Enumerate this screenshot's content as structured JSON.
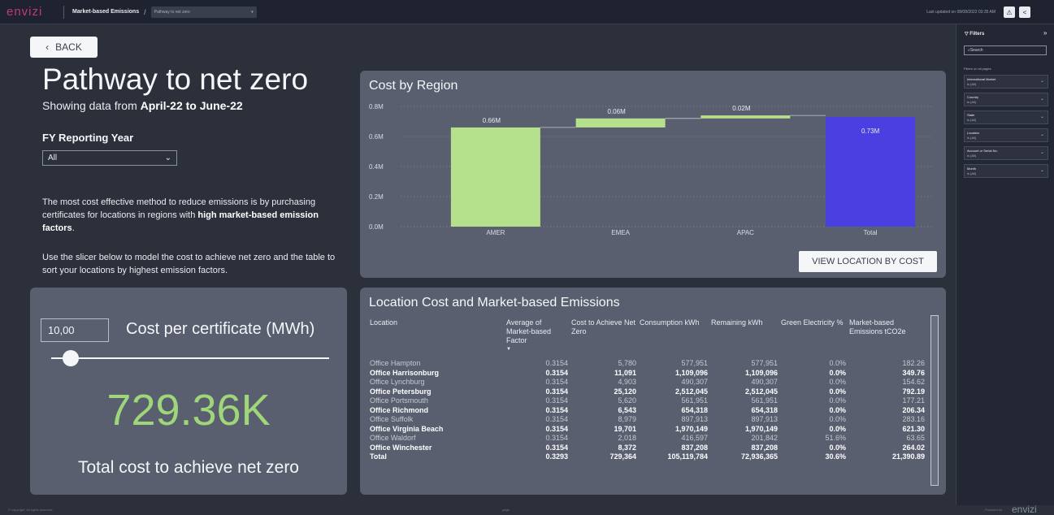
{
  "topbar": {
    "logo": "envizi",
    "report": "Market-based Emissions",
    "slash": "/",
    "page_selector": "Pathway to net zero",
    "updated": "Last updated on 08/08/2022 03:35 AM"
  },
  "left": {
    "back_label": "BACK",
    "title": "Pathway to net zero",
    "subtitle_prefix": "Showing data from",
    "subtitle_range": "April-22 to June-22",
    "fy_title": "FY Reporting Year",
    "fy_value": "All",
    "para1_a": "The most cost effective method to reduce emissions is by purchasing certificates for locations in regions with",
    "para1_b": "high market-based emission factors",
    "para1_c": ".",
    "para2": "Use the slicer below to model the cost to achieve net zero and the table to sort your locations by highest emission factors."
  },
  "model": {
    "input_value": "10,00",
    "input_label": "Cost per certificate (MWh)",
    "slider_fraction": 0.07,
    "big_value": "729.36K",
    "caption": "Total cost to achieve net zero"
  },
  "chart": {
    "title": "Cost by Region",
    "view_button": "VIEW LOCATION BY COST"
  },
  "chart_data": {
    "type": "bar",
    "subtype": "waterfall",
    "categories": [
      "AMER",
      "EMEA",
      "APAC",
      "Total"
    ],
    "values": [
      0.66,
      0.06,
      0.02,
      0.73
    ],
    "data_labels": [
      "0.66M",
      "0.06M",
      "0.02M",
      "0.73M"
    ],
    "y_ticks": [
      "0.0M",
      "0.2M",
      "0.4M",
      "0.6M",
      "0.8M"
    ],
    "ylim": [
      0,
      0.8
    ],
    "colors": {
      "increase": "#b5e08c",
      "total": "#4a3fe0"
    },
    "grid": true
  },
  "table": {
    "title": "Location Cost and Market-based Emissions",
    "headers": [
      "Location",
      "Average of Market-based Factor",
      "Cost to Achieve Net Zero",
      "Consumption kWh",
      "Remaining kWh",
      "Green Electricity %",
      "Market-based Emissions tCO2e"
    ],
    "rows": [
      [
        "Office Hampton",
        "0.3154",
        "5,780",
        "577,951",
        "577,951",
        "0.0%",
        "182.26"
      ],
      [
        "Office Harrisonburg",
        "0.3154",
        "11,091",
        "1,109,096",
        "1,109,096",
        "0.0%",
        "349.76"
      ],
      [
        "Office Lynchburg",
        "0.3154",
        "4,903",
        "490,307",
        "490,307",
        "0.0%",
        "154.62"
      ],
      [
        "Office Petersburg",
        "0.3154",
        "25,120",
        "2,512,045",
        "2,512,045",
        "0.0%",
        "792.19"
      ],
      [
        "Office Portsmouth",
        "0.3154",
        "5,620",
        "561,951",
        "561,951",
        "0.0%",
        "177.21"
      ],
      [
        "Office Richmond",
        "0.3154",
        "6,543",
        "654,318",
        "654,318",
        "0.0%",
        "206.34"
      ],
      [
        "Office Suffolk",
        "0.3154",
        "8,979",
        "897,913",
        "897,913",
        "0.0%",
        "283.16"
      ],
      [
        "Office Virginia Beach",
        "0.3154",
        "19,701",
        "1,970,149",
        "1,970,149",
        "0.0%",
        "621.30"
      ],
      [
        "Office Waldorf",
        "0.3154",
        "2,018",
        "416,597",
        "201,842",
        "51.6%",
        "63.65"
      ],
      [
        "Office Winchester",
        "0.3154",
        "8,372",
        "837,208",
        "837,208",
        "0.0%",
        "264.02"
      ]
    ],
    "total": [
      "Total",
      "0.3293",
      "729,364",
      "105,119,784",
      "72,936,365",
      "30.6%",
      "21,390.89"
    ]
  },
  "filters": {
    "title": "Filters",
    "search_placeholder": "Search",
    "section": "Filters on all pages",
    "items": [
      {
        "name": "International Market",
        "value": "is (All)"
      },
      {
        "name": "Country",
        "value": "is (All)"
      },
      {
        "name": "State",
        "value": "is (All)"
      },
      {
        "name": "Location",
        "value": "is (All)"
      },
      {
        "name": "Account or Serial No.",
        "value": "is (All)"
      },
      {
        "name": "Month",
        "value": "is (All)"
      }
    ]
  },
  "footer": {
    "copyright": "© copyright. All rights reserved.",
    "page": "page",
    "powered_by": "Powered by",
    "logo": "envizi"
  }
}
